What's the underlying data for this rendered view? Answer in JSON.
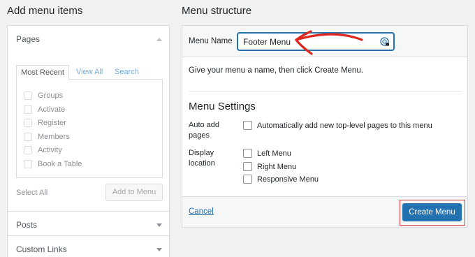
{
  "left": {
    "heading": "Add menu items",
    "pages": {
      "title": "Pages",
      "tabs": [
        "Most Recent",
        "View All",
        "Search"
      ],
      "items": [
        "Groups",
        "Activate",
        "Register",
        "Members",
        "Activity",
        "Book a Table"
      ],
      "select_all": "Select All",
      "add_button": "Add to Menu"
    },
    "posts_title": "Posts",
    "custom_links_title": "Custom Links"
  },
  "right": {
    "heading": "Menu structure",
    "menu_name_label": "Menu Name",
    "menu_name_value": "Footer Menu",
    "instructions": "Give your menu a name, then click Create Menu.",
    "settings_title": "Menu Settings",
    "auto_add": {
      "label_line1": "Auto add",
      "label_line2": "pages",
      "option": "Automatically add new top-level pages to this menu"
    },
    "display_location": {
      "label_line1": "Display",
      "label_line2": "location",
      "options": [
        "Left Menu",
        "Right Menu",
        "Responsive Menu"
      ]
    },
    "cancel": "Cancel",
    "create_button": "Create Menu"
  },
  "colors": {
    "primary": "#2271b1",
    "annotation_red": "#e0271e",
    "background": "#f1f1f1"
  }
}
